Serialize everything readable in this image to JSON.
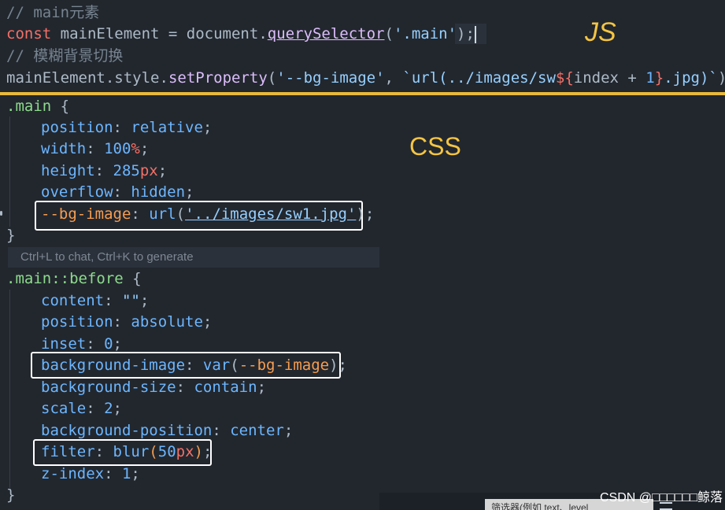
{
  "js": {
    "comment1": "// main元素",
    "line1": {
      "kw": "const",
      "name": " mainElement = ",
      "obj": "document",
      "dot": ".",
      "method": "querySelector",
      "open": "(",
      "arg": "'.main'",
      "close": ");"
    },
    "comment2": "// 模糊背景切换",
    "line2": {
      "obj": "mainElement",
      "dot1": ".",
      "prop": "style",
      "dot2": ".",
      "method": "setProperty",
      "open": "(",
      "arg1": "'--bg-image'",
      "comma": ", ",
      "tmpl_start": "`url(../images/sw",
      "tmpl_expr_open": "${",
      "expr": "index + ",
      "num": "1",
      "tmpl_expr_close": "}",
      "tmpl_end": ".jpg)`",
      "close": ");"
    }
  },
  "labels": {
    "js": "JS",
    "css": "CSS"
  },
  "css": {
    "rule1": {
      "selector": ".main",
      "open": " {",
      "decls": [
        {
          "prop": "position",
          "value": "relative"
        },
        {
          "prop": "width",
          "num": "100",
          "unit": "%"
        },
        {
          "prop": "height",
          "num": "285",
          "unit": "px"
        },
        {
          "prop": "overflow",
          "value": "hidden"
        }
      ],
      "bg_decl": {
        "prop": "--bg-image",
        "fn": "url",
        "arg": "'../images/sw1.jpg'"
      },
      "close": "}"
    },
    "hint": "Ctrl+L to chat, Ctrl+K to generate",
    "rule2": {
      "selector": ".main::before",
      "open": " {",
      "decls": [
        {
          "prop": "content",
          "value": "\"\""
        },
        {
          "prop": "position",
          "value": "absolute"
        },
        {
          "prop": "inset",
          "num": "0"
        },
        {
          "prop": "background-image",
          "fn": "var",
          "arg": "--bg-image"
        },
        {
          "prop": "background-size",
          "value": "contain"
        },
        {
          "prop": "scale",
          "num": "2"
        },
        {
          "prop": "background-position",
          "value": "center"
        },
        {
          "prop": "filter",
          "fn": "blur",
          "num": "50",
          "unit": "px"
        },
        {
          "prop": "z-index",
          "num": "1"
        }
      ],
      "close": "}"
    }
  },
  "bottom_bar": {
    "tab_label": "筛选器(例如 text、level",
    "watermark": "CSDN @□□□□□□鲸落"
  }
}
